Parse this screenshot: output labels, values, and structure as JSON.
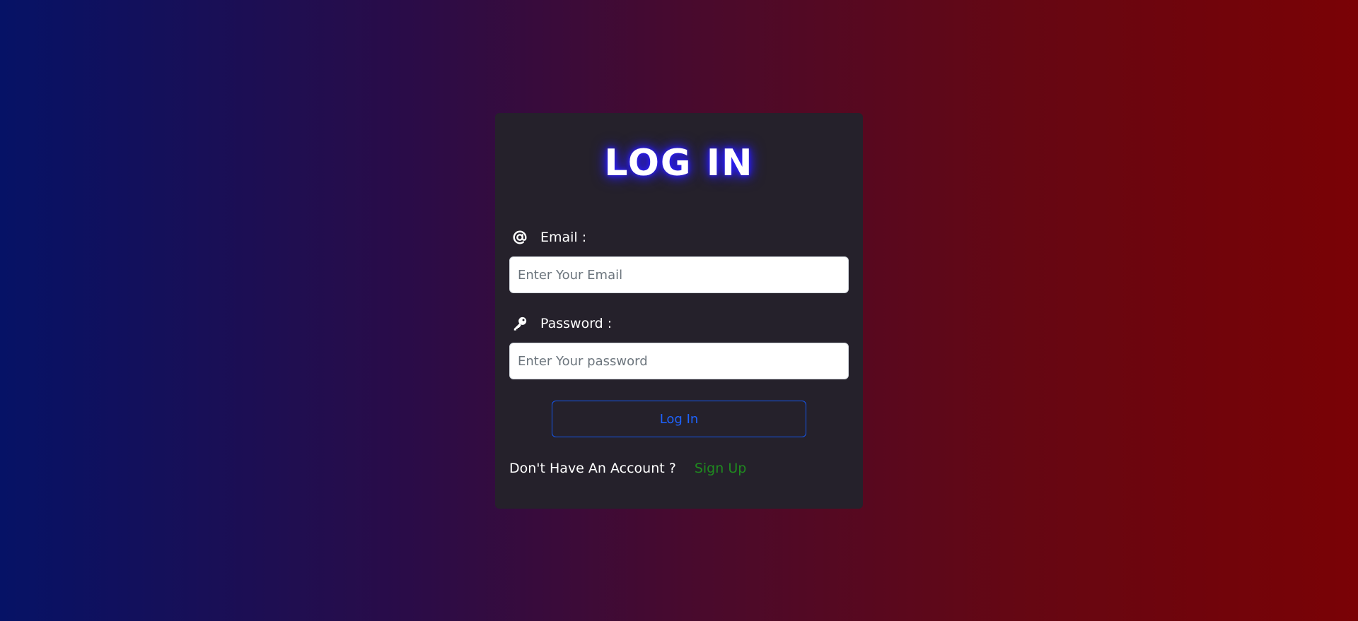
{
  "login": {
    "title": "LOG IN",
    "email": {
      "label": "Email :",
      "icon": "at-icon",
      "placeholder": "Enter Your Email",
      "value": ""
    },
    "password": {
      "label": "Password :",
      "icon": "key-icon",
      "placeholder": "Enter Your password",
      "value": ""
    },
    "submit_label": "Log In",
    "signup_prompt": "Don't Have An Account ?",
    "signup_link": "Sign Up"
  },
  "colors": {
    "background_left": "#061266",
    "background_right": "#7a0205",
    "card": "#25212b",
    "title_glow": "#2b1dff",
    "button_accent": "#1e63ff",
    "signup_link": "#1f8a1f"
  }
}
